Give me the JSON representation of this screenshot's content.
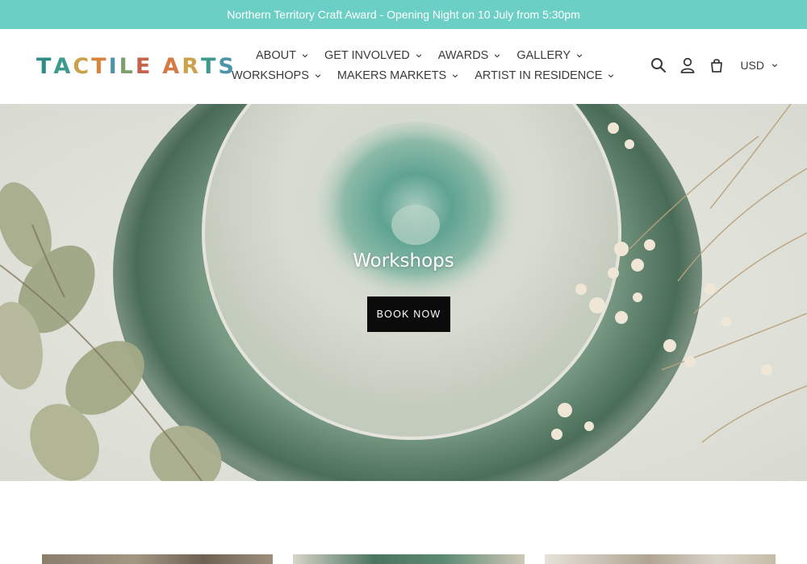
{
  "announcement": {
    "text": "Northern Territory Craft Award - Opening Night on 10 July from 5:30pm"
  },
  "header": {
    "logo": {
      "letters_first": [
        "T",
        "A",
        "C",
        "T",
        "I",
        "L",
        "E"
      ],
      "letters_second": [
        "A",
        "R",
        "T",
        "S"
      ],
      "colors": [
        "#2e8b86",
        "#3f9a8e",
        "#c9a24a",
        "#d8843a",
        "#4c95a8",
        "#7aa06b",
        "#c4634a",
        "#d47a44",
        "#c9a24a",
        "#3f9a8e",
        "#4c95a8"
      ]
    },
    "nav_row1": [
      {
        "label": "ABOUT"
      },
      {
        "label": "GET INVOLVED"
      },
      {
        "label": "AWARDS"
      },
      {
        "label": "GALLERY"
      }
    ],
    "nav_row2": [
      {
        "label": "WORKSHOPS"
      },
      {
        "label": "MAKERS MARKETS"
      },
      {
        "label": "ARTIST IN RESIDENCE"
      }
    ],
    "icons": [
      "search-icon",
      "account-icon",
      "cart-icon"
    ],
    "currency": "USD"
  },
  "hero": {
    "title": "Workshops",
    "button_label": "BOOK NOW"
  },
  "colors": {
    "announcement_bg": "#6ccfc5",
    "button_bg": "#0b0b0b",
    "text": "#3a3a3a"
  }
}
